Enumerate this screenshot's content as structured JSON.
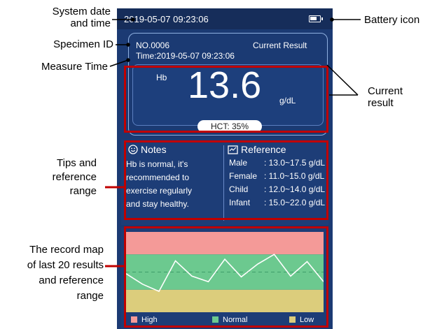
{
  "device": {
    "datetime": "2019-05-07   09:23:06",
    "specimen_id": "NO.0006",
    "measure_time": "Time:2019-05-07 09:23:06",
    "current_result_label": "Current Result",
    "param": "Hb",
    "value": "13.6",
    "unit": "g/dL",
    "hct": "HCT: 35%",
    "notes": {
      "title": "Notes",
      "lines": [
        "Hb is normal, it's",
        "recommended to",
        "exercise regularly",
        "and stay healthy."
      ]
    },
    "reference": {
      "title": "Reference",
      "rows": [
        {
          "name": "Male",
          "range": ": 13.0~17.5 g/dL"
        },
        {
          "name": "Female",
          "range": ": 11.0~15.0 g/dL"
        },
        {
          "name": "Child",
          "range": ": 12.0~14.0 g/dL"
        },
        {
          "name": "Infant",
          "range": ": 15.0~22.0 g/dL"
        }
      ]
    },
    "chart_data": {
      "type": "line",
      "title": "",
      "xlabel": "",
      "ylabel": "",
      "bands": [
        {
          "name": "High",
          "color": "#f49a98"
        },
        {
          "name": "Normal",
          "color": "#6cc98f"
        },
        {
          "name": "Low",
          "color": "#dccd7c"
        }
      ],
      "band_edges": [
        0,
        0.28,
        0.31,
        0.72,
        1
      ],
      "x": [
        0,
        1,
        2,
        3,
        4,
        5,
        6,
        7,
        8,
        9,
        10,
        11,
        12
      ],
      "y": [
        0.52,
        0.65,
        0.74,
        0.36,
        0.55,
        0.62,
        0.34,
        0.56,
        0.4,
        0.28,
        0.55,
        0.37,
        0.62
      ],
      "line_color": "#ffffff"
    },
    "legend": {
      "high": "High",
      "normal": "Normal",
      "low": "Low"
    },
    "colors": {
      "screen": "#1b3a73",
      "highlight": "#c00000"
    }
  },
  "annotations": {
    "system_datetime": [
      "System date",
      "and time"
    ],
    "specimen_id": "Specimen ID",
    "measure_time": "Measure Time",
    "battery_icon": "Battery icon",
    "current_result": [
      "Current",
      "result"
    ],
    "tips": [
      "Tips and",
      "reference",
      "range"
    ],
    "record_map": [
      "The record map",
      "of last 20 results",
      "and reference",
      "range"
    ]
  }
}
